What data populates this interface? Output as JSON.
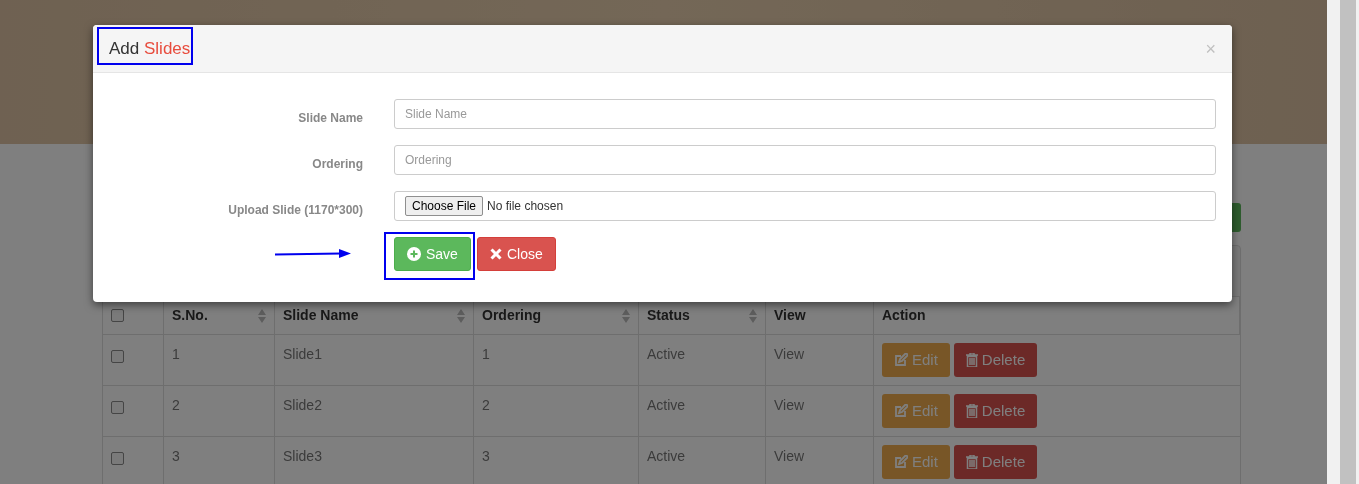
{
  "table": {
    "select_all": {
      "checked": false
    },
    "columns": [
      {
        "label": "S.No.",
        "sortable": true
      },
      {
        "label": "Slide Name",
        "sortable": true
      },
      {
        "label": "Ordering",
        "sortable": true
      },
      {
        "label": "Status",
        "sortable": true
      },
      {
        "label": "View",
        "sortable": false
      },
      {
        "label": "Action",
        "sortable": false
      }
    ],
    "rows": [
      {
        "checked": false,
        "cells": [
          "1",
          "Slide1",
          "1",
          "Active",
          "View"
        ],
        "actions": [
          "Edit",
          "Delete"
        ]
      },
      {
        "checked": false,
        "cells": [
          "2",
          "Slide2",
          "2",
          "Active",
          "View"
        ],
        "actions": [
          "Edit",
          "Delete"
        ]
      },
      {
        "checked": false,
        "cells": [
          "3",
          "Slide3",
          "3",
          "Active",
          "View"
        ],
        "actions": [
          "Edit",
          "Delete"
        ]
      }
    ]
  },
  "modal": {
    "title": "Add",
    "title_accent": "Slides",
    "title_highlighted": true,
    "close": "×",
    "fields": [
      {
        "kind": "text",
        "label": "Slide Name",
        "placeholder": "Slide Name"
      },
      {
        "kind": "text",
        "label": "Ordering",
        "placeholder": "Ordering"
      },
      {
        "kind": "file",
        "label": "Upload Slide (1170*300)",
        "button": "Choose File",
        "value": "No file chosen"
      }
    ],
    "buttons": [
      {
        "kind": "save",
        "label": "Save",
        "highlighted": true
      },
      {
        "kind": "close",
        "label": "Close",
        "highlighted": false
      }
    ]
  }
}
